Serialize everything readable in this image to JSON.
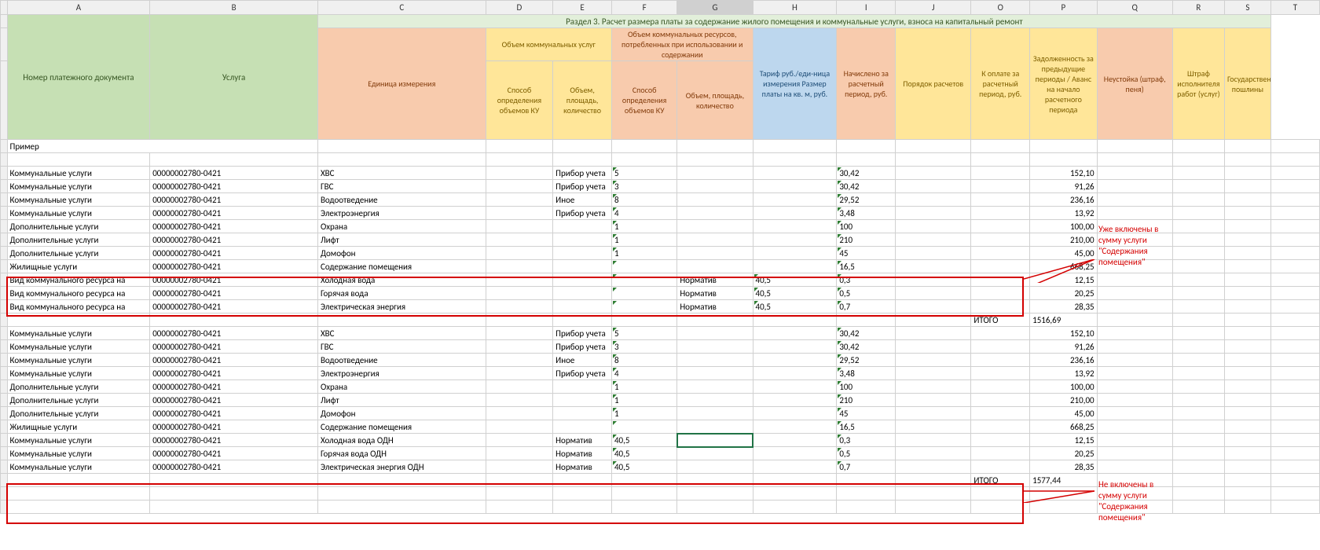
{
  "columns": [
    "A",
    "B",
    "C",
    "D",
    "E",
    "F",
    "G",
    "H",
    "I",
    "J",
    "O",
    "P",
    "Q",
    "R",
    "S",
    "T"
  ],
  "section_title": "Раздел 3. Расчет размера платы за содержание жилого помещения и коммунальные услуги, взноса на капитальный ремонт",
  "headers": {
    "doc_num": "Номер платежного документа",
    "service": "Услуга",
    "unit": "Единица измерения",
    "ku_vol_group": "Объем коммунальных услуг",
    "method_ku": "Способ определения объемов КУ",
    "vol_qty": "Объем, площадь, количество",
    "kr_vol_group": "Объем коммунальных ресурсов, потребленных при использовании и содержании",
    "method_kr": "Способ определения объемов КУ",
    "vol_qty2": "Объем, площадь, количество",
    "tariff": "Тариф руб./еди-ница измерения Размер платы на кв. м, руб.",
    "accrued": "Начислено за расчетный период, руб.",
    "calc_order": "Порядок расчетов",
    "to_pay": "К оплате за расчетный период, руб.",
    "debt": "Задолженность за предыдущие периоды / Аванс на начало расчетного периода",
    "penalty": "Неустойка (штраф, пеня)",
    "exec_fine": "Штраф исполнителя работ (услуг)",
    "gov_duty": "Государственные пошлины"
  },
  "example_label": "Пример",
  "rows_block1": [
    {
      "cat": "Коммунальные услуги",
      "doc": "00000002780-0421",
      "svc": "ХВС",
      "method": "Прибор учета",
      "vol": "5",
      "tariff": "30,42",
      "pay": "152,10"
    },
    {
      "cat": "Коммунальные услуги",
      "doc": "00000002780-0421",
      "svc": "ГВС",
      "method": "Прибор учета",
      "vol": "3",
      "tariff": "30,42",
      "pay": "91,26"
    },
    {
      "cat": "Коммунальные услуги",
      "doc": "00000002780-0421",
      "svc": "Водоотведение",
      "method": "Иное",
      "vol": "8",
      "tariff": "29,52",
      "pay": "236,16"
    },
    {
      "cat": "Коммунальные услуги",
      "doc": "00000002780-0421",
      "svc": "Электроэнергия",
      "method": "Прибор учета",
      "vol": "4",
      "tariff": "3,48",
      "pay": "13,92"
    },
    {
      "cat": "Дополнительные услуги",
      "doc": "00000002780-0421",
      "svc": "Охрана",
      "method": "",
      "vol": "1",
      "tariff": "100",
      "pay": "100,00"
    },
    {
      "cat": "Дополнительные услуги",
      "doc": "00000002780-0421",
      "svc": "Лифт",
      "method": "",
      "vol": "1",
      "tariff": "210",
      "pay": "210,00"
    },
    {
      "cat": "Дополнительные услуги",
      "doc": "00000002780-0421",
      "svc": "Домофон",
      "method": "",
      "vol": "1",
      "tariff": "45",
      "pay": "45,00"
    },
    {
      "cat": "Жилищные услуги",
      "doc": "00000002780-0421",
      "svc": "Содержание помещения",
      "method": "",
      "vol": "",
      "tariff": "16,5",
      "pay": "668,25"
    }
  ],
  "rows_block1_red": [
    {
      "cat": "Вид коммунального ресурса на",
      "doc": "00000002780-0421",
      "svc": "Холодная вода",
      "method_kr": "Норматив",
      "vol_kr": "40,5",
      "tariff": "0,3",
      "pay": "12,15"
    },
    {
      "cat": "Вид коммунального ресурса на",
      "doc": "00000002780-0421",
      "svc": "Горячая вода",
      "method_kr": "Норматив",
      "vol_kr": "40,5",
      "tariff": "0,5",
      "pay": "20,25"
    },
    {
      "cat": "Вид коммунального ресурса на",
      "doc": "00000002780-0421",
      "svc": "Электрическая энергия",
      "method_kr": "Норматив",
      "vol_kr": "40,5",
      "tariff": "0,7",
      "pay": "28,35"
    }
  ],
  "total1": {
    "label": "ИТОГО",
    "value": "1516,69"
  },
  "rows_block2": [
    {
      "cat": "Коммунальные услуги",
      "doc": "00000002780-0421",
      "svc": "ХВС",
      "method": "Прибор учета",
      "vol": "5",
      "tariff": "30,42",
      "pay": "152,10"
    },
    {
      "cat": "Коммунальные услуги",
      "doc": "00000002780-0421",
      "svc": "ГВС",
      "method": "Прибор учета",
      "vol": "3",
      "tariff": "30,42",
      "pay": "91,26"
    },
    {
      "cat": "Коммунальные услуги",
      "doc": "00000002780-0421",
      "svc": "Водоотведение",
      "method": "Иное",
      "vol": "8",
      "tariff": "29,52",
      "pay": "236,16"
    },
    {
      "cat": "Коммунальные услуги",
      "doc": "00000002780-0421",
      "svc": "Электроэнергия",
      "method": "Прибор учета",
      "vol": "4",
      "tariff": "3,48",
      "pay": "13,92"
    },
    {
      "cat": "Дополнительные услуги",
      "doc": "00000002780-0421",
      "svc": "Охрана",
      "method": "",
      "vol": "1",
      "tariff": "100",
      "pay": "100,00"
    },
    {
      "cat": "Дополнительные услуги",
      "doc": "00000002780-0421",
      "svc": "Лифт",
      "method": "",
      "vol": "1",
      "tariff": "210",
      "pay": "210,00"
    },
    {
      "cat": "Дополнительные услуги",
      "doc": "00000002780-0421",
      "svc": "Домофон",
      "method": "",
      "vol": "1",
      "tariff": "45",
      "pay": "45,00"
    },
    {
      "cat": "Жилищные услуги",
      "doc": "00000002780-0421",
      "svc": "Содержание помещения",
      "method": "",
      "vol": "",
      "tariff": "16,5",
      "pay": "668,25"
    }
  ],
  "rows_block2_red": [
    {
      "cat": "Коммунальные услуги",
      "doc": "00000002780-0421",
      "svc": "Холодная вода ОДН",
      "method": "Норматив",
      "vol": "40,5",
      "tariff": "0,3",
      "pay": "12,15"
    },
    {
      "cat": "Коммунальные услуги",
      "doc": "00000002780-0421",
      "svc": "Горячая вода ОДН",
      "method": "Норматив",
      "vol": "40,5",
      "tariff": "0,5",
      "pay": "20,25"
    },
    {
      "cat": "Коммунальные услуги",
      "doc": "00000002780-0421",
      "svc": "Электрическая энергия ОДН",
      "method": "Норматив",
      "vol": "40,5",
      "tariff": "0,7",
      "pay": "28,35"
    }
  ],
  "total2": {
    "label": "ИТОГО",
    "value": "1577,44"
  },
  "annotations": {
    "note1": "Уже включены в сумму услуги \"Содержания помещения\"",
    "note2": "Не включены в сумму услуги \"Содержания помещения\""
  }
}
